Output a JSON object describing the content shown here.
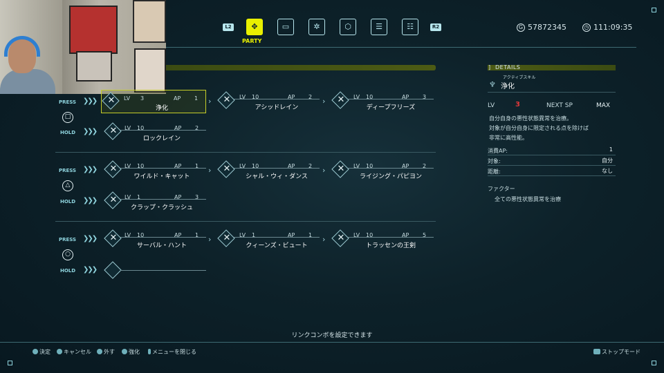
{
  "top": {
    "l2": "L2",
    "r2": "R2",
    "active_tab_label": "PARTY",
    "tabs": [
      {
        "icon": "party-icon",
        "glyph": "✥"
      },
      {
        "icon": "card-icon",
        "glyph": "▭"
      },
      {
        "icon": "network-icon",
        "glyph": "✲"
      },
      {
        "icon": "hexagon-icon",
        "glyph": "⬡"
      },
      {
        "icon": "list-icon",
        "glyph": "☰"
      },
      {
        "icon": "settings-icon",
        "glyph": "☷"
      }
    ],
    "gil": "57872345",
    "playtime": "111:09:35"
  },
  "rows": [
    {
      "button": "□",
      "press": "PRESS",
      "hold": "HOLD",
      "press_skills": [
        {
          "lv_label": "LV",
          "lv": "3",
          "ap_label": "AP",
          "ap": "1",
          "name": "浄化"
        },
        {
          "lv_label": "LV",
          "lv": "10",
          "ap_label": "AP",
          "ap": "2",
          "name": "アシッドレイン"
        },
        {
          "lv_label": "LV",
          "lv": "10",
          "ap_label": "AP",
          "ap": "3",
          "name": "ディープフリーズ"
        }
      ],
      "hold_skills": [
        {
          "lv_label": "LV",
          "lv": "10",
          "ap_label": "AP",
          "ap": "2",
          "name": "ロックレイン"
        }
      ]
    },
    {
      "button": "△",
      "press": "PRESS",
      "hold": "HOLD",
      "press_skills": [
        {
          "lv_label": "LV",
          "lv": "10",
          "ap_label": "AP",
          "ap": "1",
          "name": "ワイルド・キャット"
        },
        {
          "lv_label": "LV",
          "lv": "10",
          "ap_label": "AP",
          "ap": "2",
          "name": "シャル・ウィ・ダンス"
        },
        {
          "lv_label": "LV",
          "lv": "10",
          "ap_label": "AP",
          "ap": "2",
          "name": "ライジング・パピヨン"
        }
      ],
      "hold_skills": [
        {
          "lv_label": "LV",
          "lv": "1",
          "ap_label": "AP",
          "ap": "3",
          "name": "クラップ・クラッシュ"
        }
      ]
    },
    {
      "button": "○",
      "press": "PRESS",
      "hold": "HOLD",
      "press_skills": [
        {
          "lv_label": "LV",
          "lv": "10",
          "ap_label": "AP",
          "ap": "1",
          "name": "サーバル・ハント"
        },
        {
          "lv_label": "LV",
          "lv": "1",
          "ap_label": "AP",
          "ap": "1",
          "name": "クィーンズ・ビュート"
        },
        {
          "lv_label": "LV",
          "lv": "10",
          "ap_label": "AP",
          "ap": "5",
          "name": "トラッセンの王剣"
        }
      ],
      "hold_skills": []
    }
  ],
  "details": {
    "header": "DETAILS",
    "skill_type": "アクティブスキル",
    "skill_name": "浄化",
    "lv_label": "LV",
    "lv_value": "3",
    "next_sp_label": "NEXT SP",
    "next_sp_value": "MAX",
    "desc1": "自分自身の悪性状態異常を治療。",
    "desc2": "対象が自分自身に限定される点を除けば",
    "desc3": "非常に高性能。",
    "ap_label": "消費AP:",
    "ap_value": "1",
    "target_label": "対象:",
    "target_value": "自分",
    "range_label": "距離:",
    "range_value": "なし",
    "factor_label": "ファクター",
    "factor_text": "全ての悪性状態異常を治療"
  },
  "footer": {
    "hint": "リンクコンボを設定できます",
    "decide": "決定",
    "cancel": "キャンセル",
    "remove": "外す",
    "enhance": "強化",
    "close_menu": "メニューを閉じる",
    "stop_mode": "ストップモード"
  },
  "colors": {
    "accent": "#e9f000",
    "cyan": "#8fd4de",
    "lv_red": "#e0383a"
  }
}
